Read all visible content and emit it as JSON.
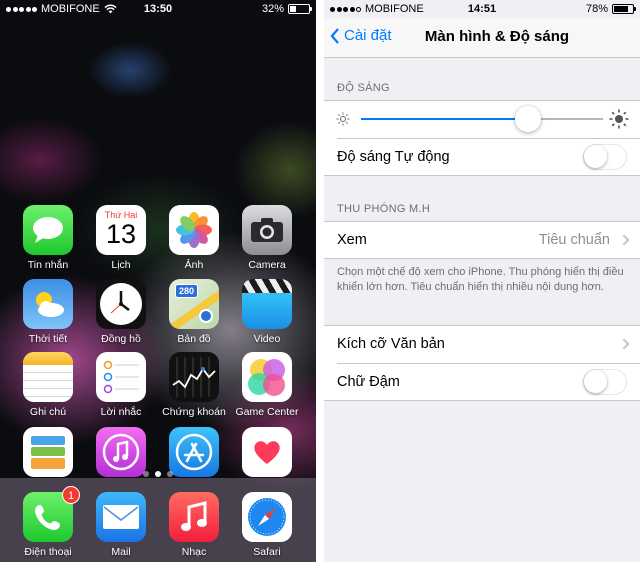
{
  "home": {
    "status": {
      "carrier": "MOBIFONE",
      "time": "13:50",
      "battery": "32%",
      "battery_level": 0.32
    },
    "apps": [
      {
        "label": "Tin nhắn",
        "icon": "messages-icon"
      },
      {
        "label": "Lịch",
        "icon": "calendar-icon",
        "weekday": "Thứ Hai",
        "day": "13"
      },
      {
        "label": "Ảnh",
        "icon": "photos-icon"
      },
      {
        "label": "Camera",
        "icon": "camera-icon"
      },
      {
        "label": "Thời tiết",
        "icon": "weather-icon"
      },
      {
        "label": "Đồng hồ",
        "icon": "clock-icon"
      },
      {
        "label": "Bản đồ",
        "icon": "maps-icon",
        "road_sign": "280"
      },
      {
        "label": "Video",
        "icon": "video-icon"
      },
      {
        "label": "Ghi chú",
        "icon": "notes-icon"
      },
      {
        "label": "Lời nhắc",
        "icon": "reminders-icon"
      },
      {
        "label": "Chứng khoán",
        "icon": "stocks-icon"
      },
      {
        "label": "Game Center",
        "icon": "game-center-icon"
      },
      {
        "label": "",
        "icon": "passbook-icon"
      },
      {
        "label": "",
        "icon": "itunes-store-icon"
      },
      {
        "label": "",
        "icon": "app-store-icon"
      },
      {
        "label": "",
        "icon": "health-icon"
      }
    ],
    "dock": [
      {
        "label": "Điện thoại",
        "icon": "phone-icon",
        "badge": "1"
      },
      {
        "label": "Mail",
        "icon": "mail-icon"
      },
      {
        "label": "Nhạc",
        "icon": "music-icon"
      },
      {
        "label": "Safari",
        "icon": "safari-icon"
      }
    ]
  },
  "settings": {
    "status": {
      "carrier": "MOBIFONE",
      "time": "14:51",
      "battery": "78%",
      "battery_level": 0.78
    },
    "nav": {
      "back_label": "Cài đặt",
      "title": "Màn hình & Độ sáng"
    },
    "brightness_section": {
      "header": "ĐỘ SÁNG",
      "level": 0.69,
      "auto_label": "Độ sáng Tự động",
      "auto_enabled": false
    },
    "zoom_section": {
      "header": "THU PHÓNG M.H",
      "view_label": "Xem",
      "view_value": "Tiêu chuẩn",
      "footer": "Chọn một chế độ xem cho iPhone. Thu phóng hiển thị điều khiển lớn hơn. Tiêu chuẩn hiển thị nhiều nội dung hơn."
    },
    "text_section": {
      "text_size_label": "Kích cỡ Văn bản",
      "bold_label": "Chữ Đậm",
      "bold_enabled": false
    },
    "colors": {
      "accent": "#007aff",
      "background": "#efeff4"
    }
  }
}
